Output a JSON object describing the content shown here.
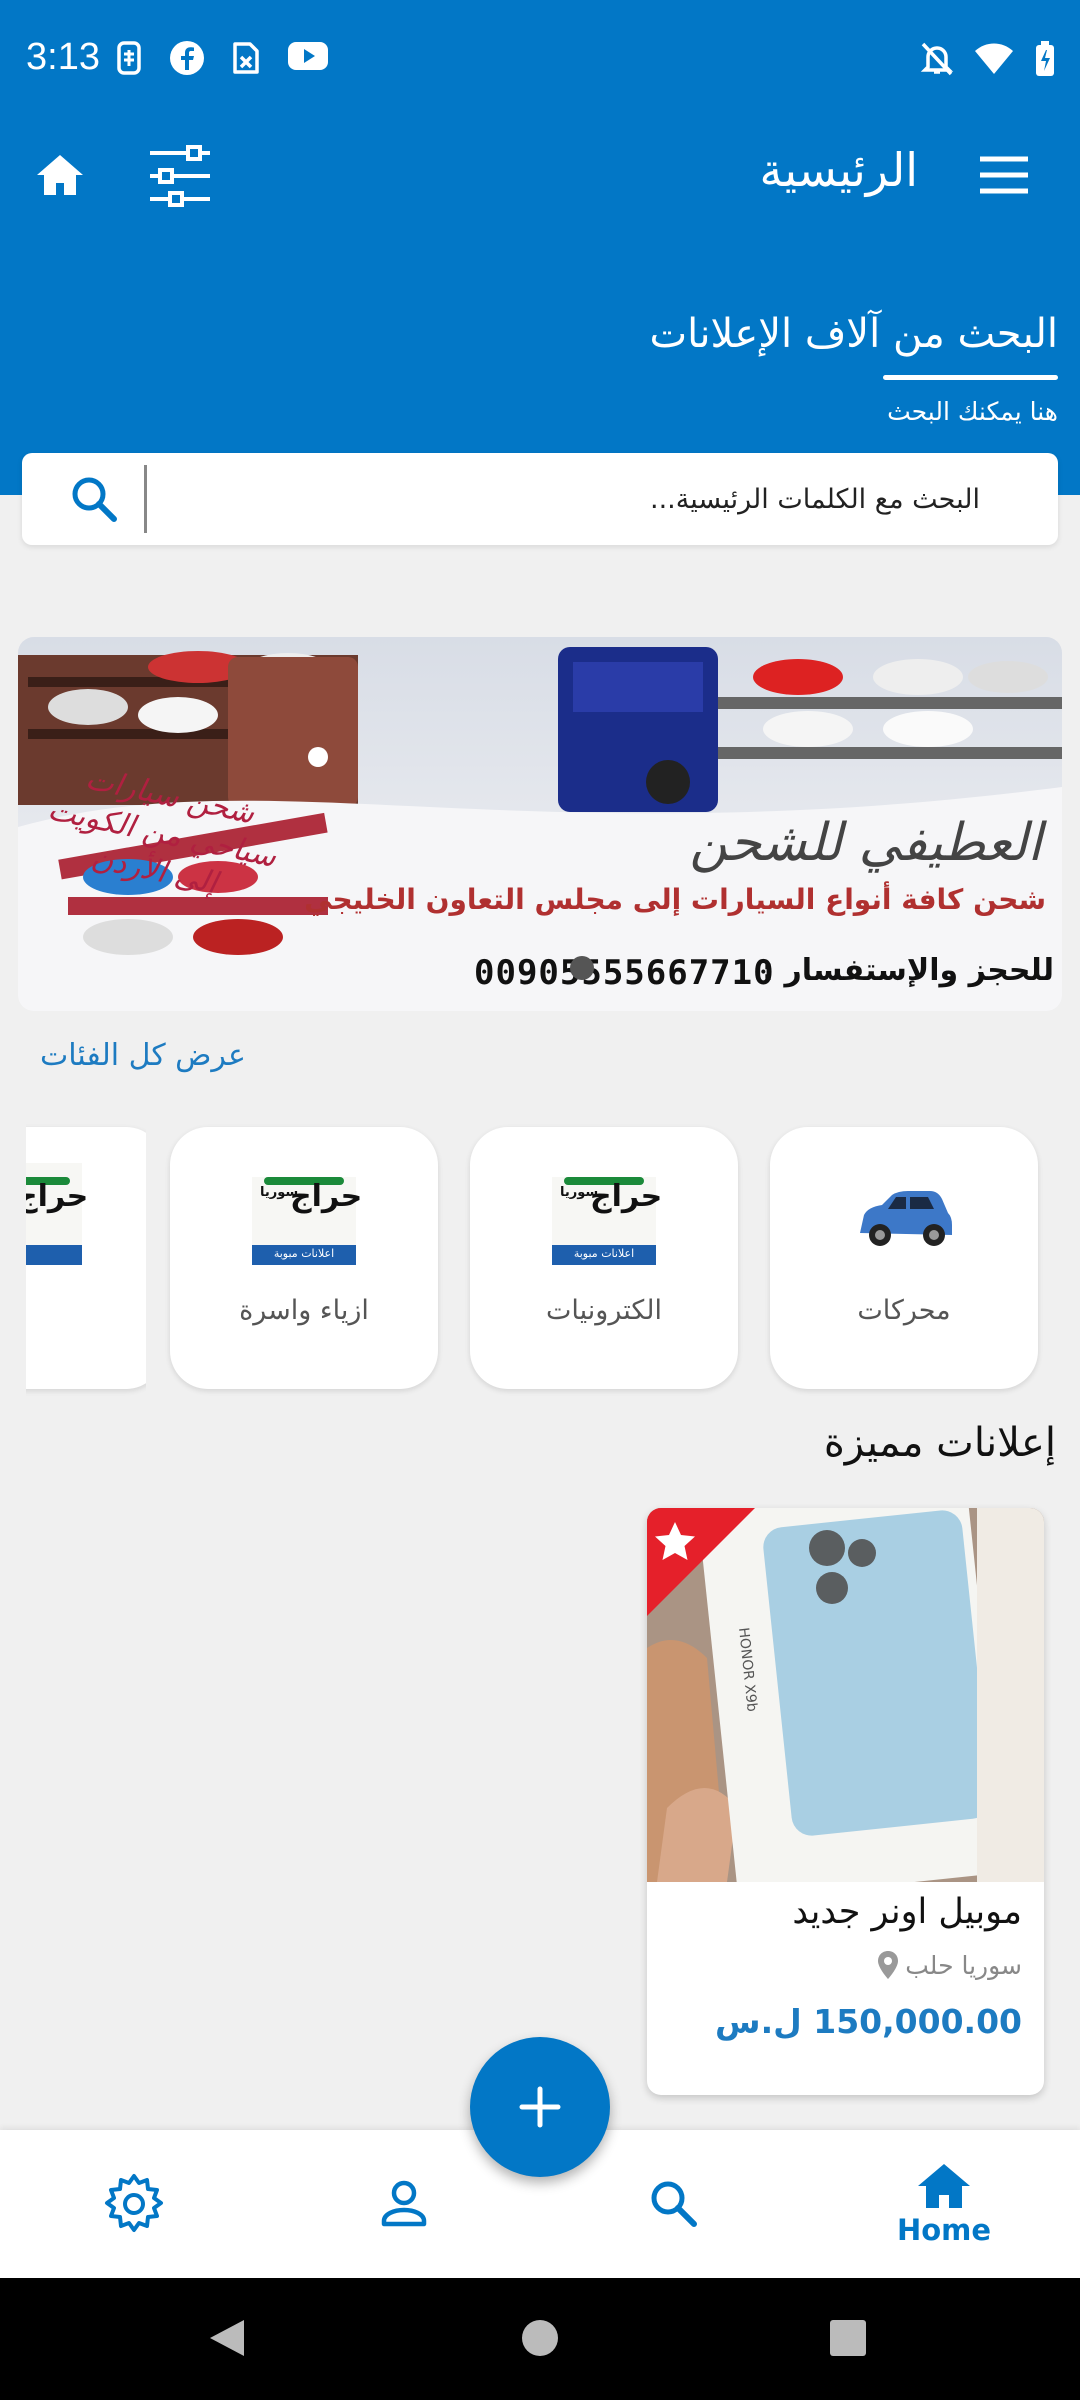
{
  "status_bar": {
    "time": "3:13",
    "left_icons": [
      "sim-icon",
      "facebook-icon",
      "screenshot-icon",
      "youtube-icon"
    ],
    "right_icons": [
      "mute-icon",
      "wifi-icon",
      "battery-icon"
    ]
  },
  "app_bar": {
    "title": "الرئيسية"
  },
  "search_section": {
    "heading": "البحث من آلاف الإعلانات",
    "subheading": "هنا يمكنك البحث",
    "placeholder": "البحث مع الكلمات الرئيسية..."
  },
  "banner": {
    "headline": "العطيفي للشحن",
    "tagline": "شحن كافة أنواع السيارات إلى مجلس التعاون الخليجي",
    "side_text": "شحن سيارات سياحي من الكويت إلى الأردن",
    "inquiry_label": "للحجز والإستفسار :",
    "phone": "00905555667710",
    "slide_count": 1,
    "active_slide": 1
  },
  "categories": {
    "view_all": "عرض كل الفئات",
    "items": [
      {
        "label": "محركات",
        "icon": "car-icon"
      },
      {
        "label": "الكترونيات",
        "icon": "haraj-logo"
      },
      {
        "label": "ازياء واسرة",
        "icon": "haraj-logo"
      },
      {
        "label": "",
        "icon": "haraj-logo"
      }
    ],
    "logo_text": "حراج",
    "logo_sub": "سوريا",
    "logo_banner": "اعلانات مبوبة"
  },
  "featured": {
    "title": "إعلانات مميزة",
    "ads": [
      {
        "title": "موبيل اونر جديد",
        "location": "سوريا حلب",
        "price": "150,000.00 ل.س",
        "featured": true,
        "photo_text": "HONOR X9b"
      }
    ]
  },
  "bottom_nav": {
    "items": [
      {
        "name": "settings",
        "label": "",
        "icon": "gear-icon"
      },
      {
        "name": "profile",
        "label": "",
        "icon": "person-icon"
      },
      {
        "name": "search",
        "label": "",
        "icon": "search-icon"
      },
      {
        "name": "home",
        "label": "Home",
        "icon": "home-icon",
        "active": true
      }
    ]
  },
  "colors": {
    "primary": "#0277c6",
    "link": "#1d7bc1",
    "background": "#f0f0f0",
    "featured_badge": "#e5202a"
  }
}
